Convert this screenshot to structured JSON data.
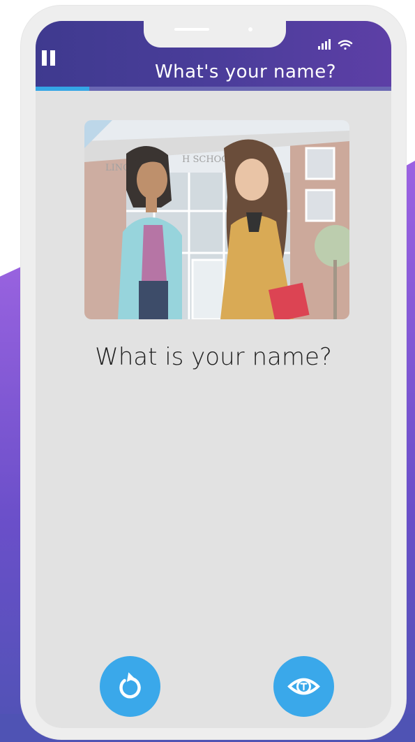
{
  "header": {
    "title": "What's your name?",
    "progress": 0.15
  },
  "scene": {
    "sign_text_left": "LINC",
    "sign_text_right": "H SCHOOL"
  },
  "prompt": {
    "question": "What is your name?"
  },
  "controls": {
    "replay_icon": "replay-icon",
    "eye_icon": "eye-icon",
    "pause_icon": "pause-icon"
  },
  "colors": {
    "header_start": "#3f3a8f",
    "header_end": "#5d3fa6",
    "accent": "#3aa8ea",
    "screen_bg": "#e2e2e2",
    "background_purple": "#9a63e0"
  }
}
